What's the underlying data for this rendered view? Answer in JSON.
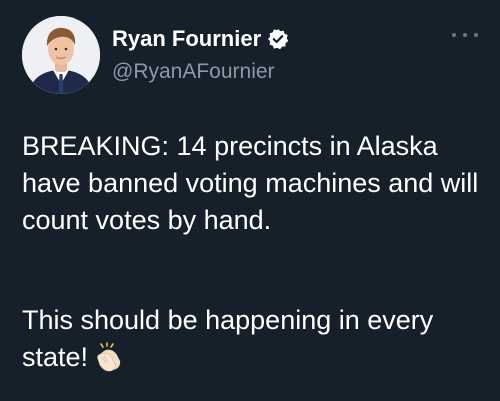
{
  "author": {
    "display_name": "Ryan Fournier",
    "handle": "@RyanAFournier",
    "verified": true
  },
  "tweet": {
    "paragraph_1": "BREAKING: 14 precincts in Alaska have banned voting machines and will count votes by hand.",
    "paragraph_2": "This should be happening in every state!",
    "emoji": "clapping-hands-emoji"
  },
  "icons": {
    "verified": "verified-badge-icon",
    "more": "more-options-icon"
  },
  "colors": {
    "background": "#15202b",
    "text": "#ffffff",
    "secondary_text": "#8b98a5",
    "verified_badge": "#ffffff"
  }
}
